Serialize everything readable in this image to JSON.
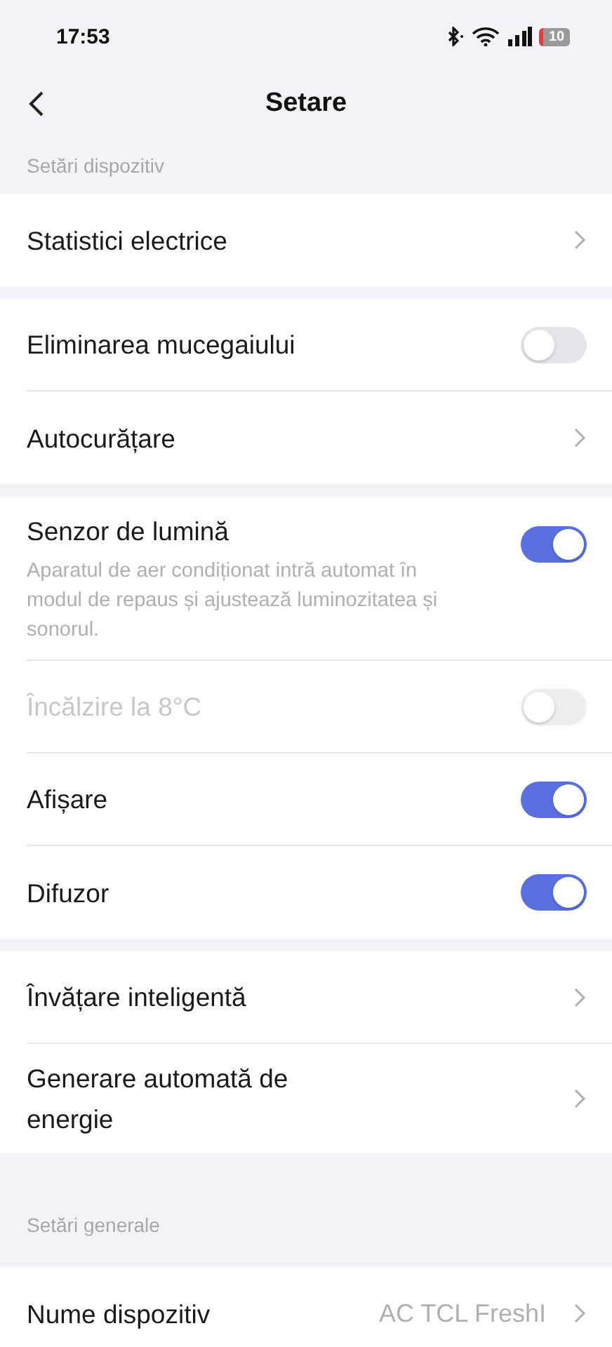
{
  "status_bar": {
    "time": "17:53",
    "battery": "10"
  },
  "header": {
    "title": "Setare"
  },
  "sections": [
    {
      "label": "Setări dispozitiv",
      "groups": [
        [
          {
            "kind": "link",
            "label": "Statistici electrice"
          }
        ],
        [
          {
            "kind": "toggle",
            "label": "Eliminarea mucegaiului",
            "on": false,
            "disabled": false
          },
          {
            "kind": "link",
            "label": "Autocurățare"
          }
        ],
        [
          {
            "kind": "toggle",
            "label": "Senzor de lumină",
            "on": true,
            "disabled": false,
            "description": "Aparatul de aer condiționat intră automat în modul de repaus și ajustează luminozitatea și sonorul."
          },
          {
            "kind": "toggle",
            "label": "Încălzire la 8°C",
            "on": false,
            "disabled": true
          },
          {
            "kind": "toggle",
            "label": "Afișare",
            "on": true,
            "disabled": false
          },
          {
            "kind": "toggle",
            "label": "Difuzor",
            "on": true,
            "disabled": false
          }
        ],
        [
          {
            "kind": "link",
            "label": "Învățare inteligentă"
          },
          {
            "kind": "link",
            "label": "Generare automată de energie"
          }
        ]
      ]
    },
    {
      "label": "Setări generale",
      "groups": [
        [
          {
            "kind": "value",
            "label": "Nume dispozitiv",
            "value": "AC TCL FreshI"
          }
        ]
      ]
    }
  ]
}
